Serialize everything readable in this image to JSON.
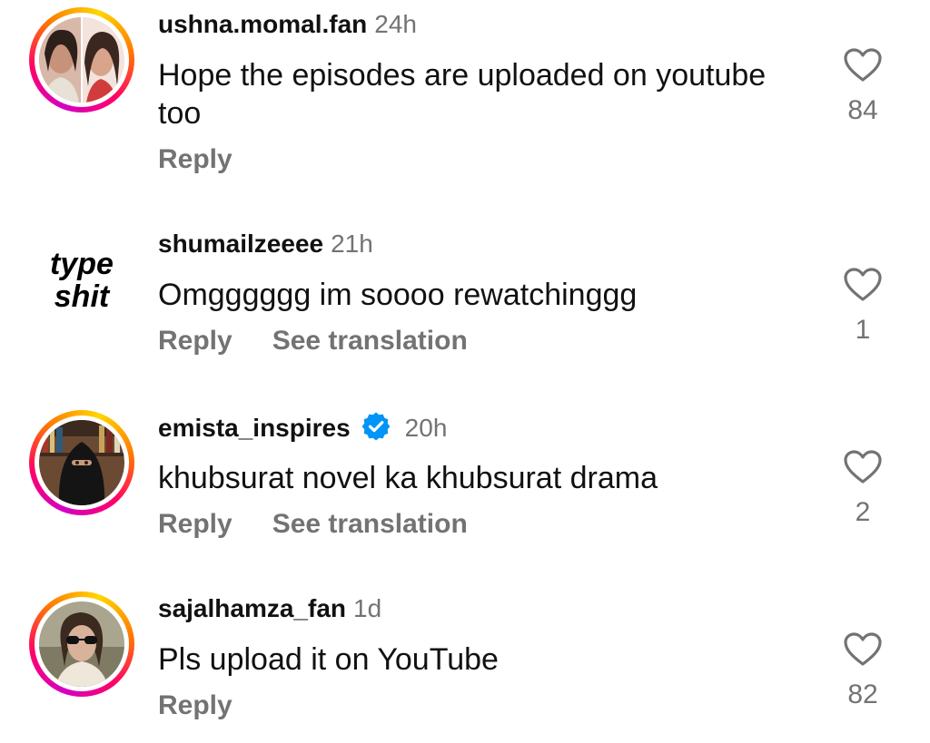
{
  "comments": [
    {
      "username": "ushna.momal.fan",
      "time": "24h",
      "text": "Hope the episodes are uploaded on youtube too",
      "reply_label": "Reply",
      "likes": "84"
    },
    {
      "username": "shumailzeeee",
      "time": "21h",
      "avatar_text_line1": "type",
      "avatar_text_line2": "shit",
      "text": "Omgggggg im soooo rewatchinggg",
      "reply_label": "Reply",
      "see_translation_label": "See translation",
      "likes": "1"
    },
    {
      "username": "emista_inspires",
      "time": "20h",
      "verified": true,
      "text": "khubsurat novel ka khubsurat drama",
      "reply_label": "Reply",
      "see_translation_label": "See translation",
      "likes": "2"
    },
    {
      "username": "sajalhamza_fan",
      "time": "1d",
      "text": "Pls upload it on YouTube",
      "reply_label": "Reply",
      "likes": "82"
    }
  ],
  "icons": {
    "like": "heart-outline-icon",
    "verified": "verified-badge-icon"
  },
  "colors": {
    "secondary_text": "#737373",
    "verified_blue": "#0095f6"
  }
}
